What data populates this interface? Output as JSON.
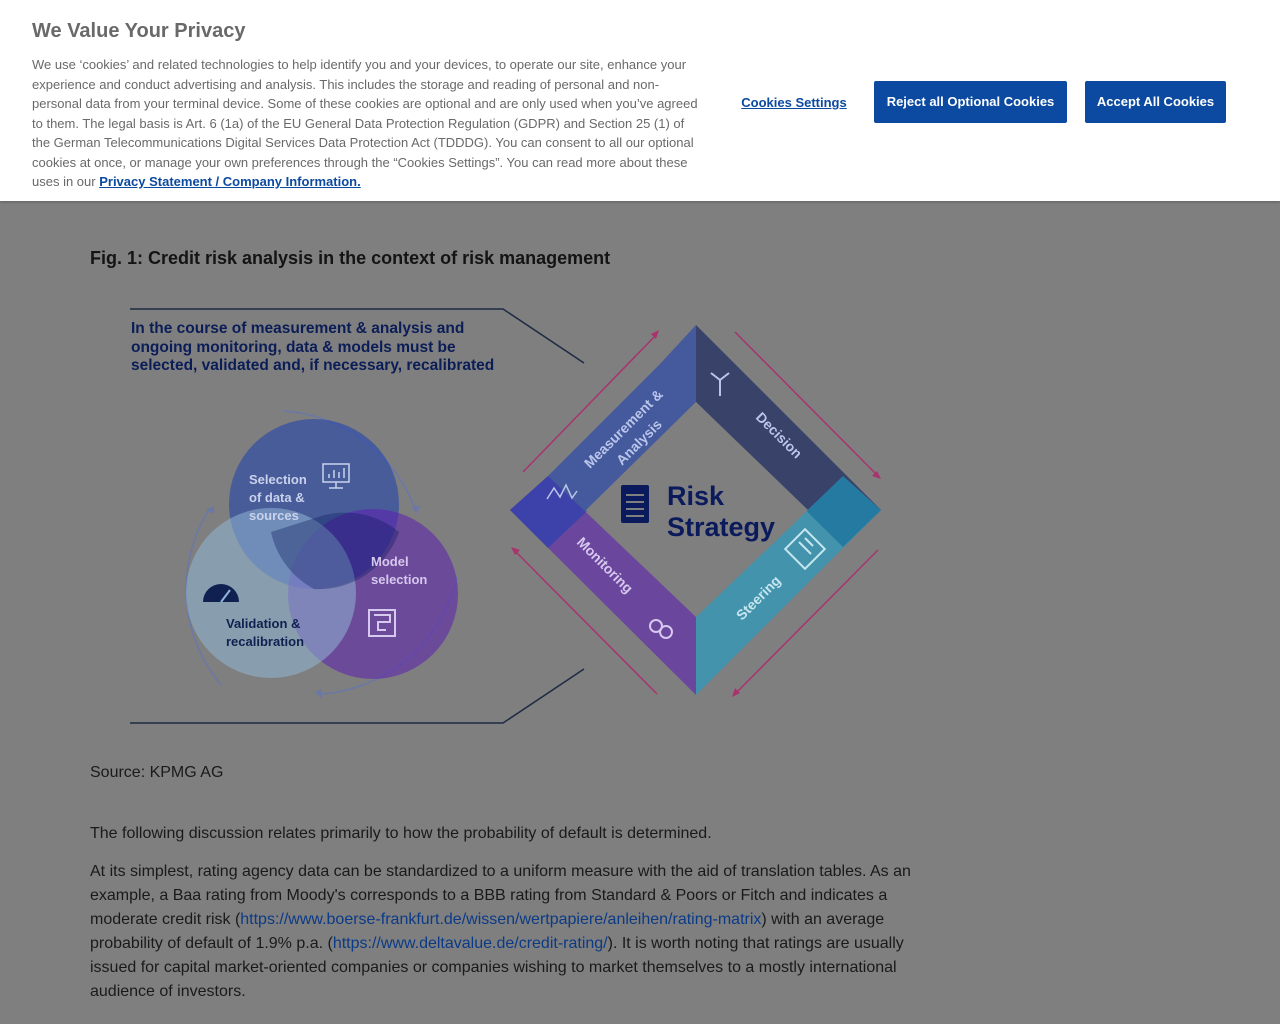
{
  "cookie_banner": {
    "title": "We Value Your Privacy",
    "description": "We use ‘cookies’ and related technologies to help identify you and your devices, to operate our site, enhance your experience and conduct advertising and analysis. This includes the storage and reading of personal and non-personal data from your terminal device. Some of these cookies are optional and are only used when you’ve agreed to them. The legal basis is Art. 6 (1a) of the EU General Data Protection Regulation (GDPR) and Section 25 (1) of the German Telecommunications Digital Services Data Protection Act (TDDDG). You can consent to all our optional cookies at once, or manage your own preferences through the “Cookies Settings”. You can read more about these uses in our",
    "privacy_link": "Privacy Statement / Company Information.",
    "settings_label": "Cookies Settings",
    "reject_label": "Reject all Optional Cookies",
    "accept_label": "Accept All Cookies",
    "button_color": "#0b4aa0"
  },
  "article": {
    "figure_title": "Fig. 1: Credit risk analysis in the context of risk management",
    "figure": {
      "callout": [
        "In the course of measurement & analysis and",
        "ongoing monitoring, data & models must be",
        "selected, validated and, if necessary, recalibrated"
      ],
      "venn": {
        "selection": [
          "Selection",
          "of data &",
          "sources"
        ],
        "model": [
          "Model",
          "selection"
        ],
        "validation": [
          "Validation &",
          "recalibration"
        ]
      },
      "diamond": {
        "measurement": [
          "Measurement &",
          "Analysis"
        ],
        "decision": "Decision",
        "steering": "Steering",
        "monitoring": "Monitoring",
        "center": [
          "Risk",
          "Strategy"
        ]
      },
      "colors": {
        "dark_navy": "#0a1a5c",
        "royal_blue": "#1e3fb0",
        "purple": "#5b1fb0",
        "light_blue": "#8fb7d4",
        "teal": "#19a0c8",
        "pink": "#d0358a"
      }
    },
    "source": "Source: KPMG AG",
    "para1": "The following discussion relates primarily to how the probability of default is determined.",
    "para2_part1": "At its simplest, rating agency data can be standardized to a uniform measure with the aid of translation tables. As an example, a Baa rating from Moody's corresponds to a BBB rating from Standard & Poors or Fitch and indicates a moderate credit risk (",
    "link1": "https://www.boerse-frankfurt.de/wissen/wertpapiere/anleihen/rating-matrix",
    "para2_part2": ") with an average probability of default of 1.9% p.a. (",
    "link2": "https://www.deltavalue.de/credit-rating/",
    "para2_part3": "). It is worth noting that ratings are usually issued for capital market-oriented companies or companies wishing to market themselves to a mostly international audience of investors."
  }
}
